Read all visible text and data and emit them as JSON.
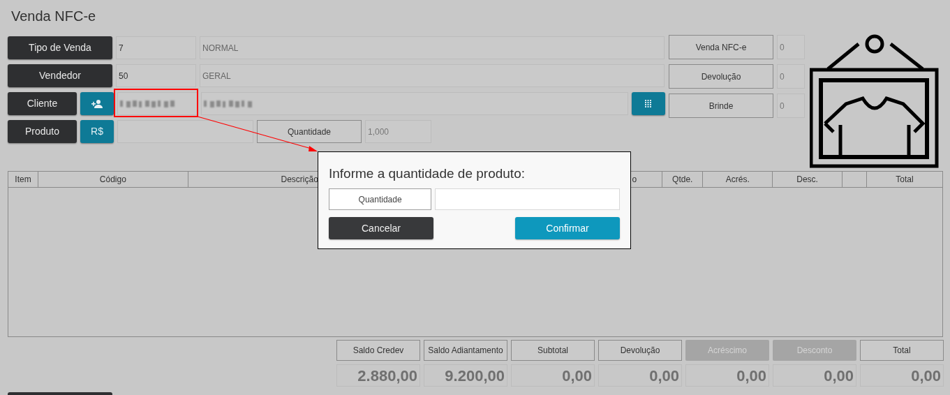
{
  "title": "Venda NFC-e",
  "fields": [
    {
      "label": "Tipo de Venda",
      "code": "7",
      "description": "NORMAL"
    },
    {
      "label": "Vendedor",
      "code": "50",
      "description": "GERAL"
    }
  ],
  "cliente": {
    "label": "Cliente"
  },
  "produto": {
    "label": "Produto",
    "currency_button": "R$",
    "quantity_label": "Quantidade",
    "quantity": "1,000"
  },
  "counters": [
    {
      "label": "Venda NFC-e",
      "value": "0"
    },
    {
      "label": "Devolução",
      "value": "0"
    },
    {
      "label": "Brinde",
      "value": "0"
    }
  ],
  "table": {
    "columns": [
      {
        "kind": "text",
        "label": "Item"
      },
      {
        "kind": "text",
        "label": "Código"
      },
      {
        "kind": "text",
        "label": "Descrição"
      },
      {
        "kind": "text",
        "label": "o"
      },
      {
        "kind": "text",
        "label": "Qtde."
      },
      {
        "kind": "text",
        "label": "Acrés."
      },
      {
        "kind": "text",
        "label": "Desc."
      },
      {
        "kind": "empty"
      },
      {
        "kind": "text",
        "label": "Total"
      }
    ]
  },
  "totals": [
    {
      "label": "Saldo Credev",
      "value": "2.880,00",
      "disabled": false
    },
    {
      "label": "Saldo Adiantamento",
      "value": "9.200,00",
      "disabled": false
    },
    {
      "label": "Subtotal",
      "value": "0,00",
      "disabled": false
    },
    {
      "label": "Devolução",
      "value": "0,00",
      "disabled": false
    },
    {
      "label": "Acréscimo",
      "value": "0,00",
      "disabled": true
    },
    {
      "label": "Desconto",
      "value": "0,00",
      "disabled": true
    },
    {
      "label": "Total",
      "value": "0,00",
      "disabled": false
    }
  ],
  "dialog": {
    "title": "Informe a quantidade de produto:",
    "field_label": "Quantidade",
    "buttons": [
      {
        "label": "Cancelar",
        "kind": "secondary"
      },
      {
        "label": "Confirmar",
        "kind": "primary"
      }
    ]
  }
}
